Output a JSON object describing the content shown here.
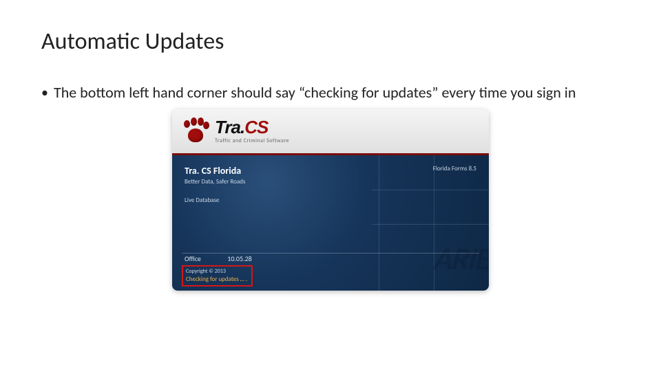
{
  "slide": {
    "title": "Automatic Updates",
    "bullet": "The bottom left hand corner should say “checking for updates” every time you sign in"
  },
  "splash": {
    "brand_prefix": "Tra.",
    "brand_red": "CS",
    "brand_subtitle": "Traffic and Criminal Software",
    "product_title": "Tra. CS Florida",
    "product_tagline": "Better Data, Safer Roads",
    "db_mode": "Live Database",
    "forms_version": "Florida Forms 8.5",
    "office_label": "Office",
    "office_version": "10.05.28",
    "copyright": "Copyright © 2013",
    "checking": "Checking for updates … .",
    "watermark": "ARIES"
  }
}
